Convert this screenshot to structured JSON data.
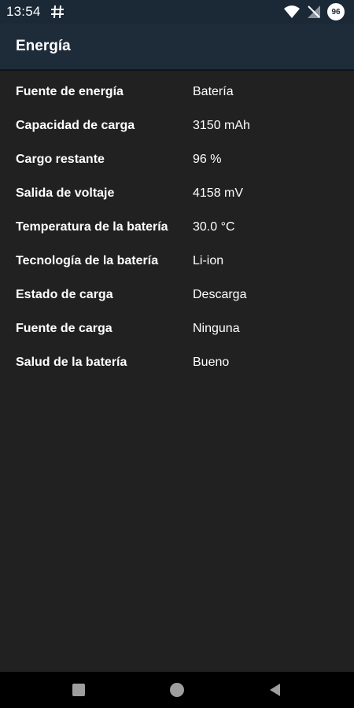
{
  "status_bar": {
    "time": "13:54",
    "battery_level": "96",
    "icons": [
      "hash-icon",
      "wifi-icon",
      "no-signal-icon",
      "battery-saver-icon"
    ]
  },
  "app_bar": {
    "title": "Energía"
  },
  "rows": [
    {
      "label": "Fuente de energía",
      "value": "Batería"
    },
    {
      "label": "Capacidad de carga",
      "value": "3150 mAh"
    },
    {
      "label": "Cargo restante",
      "value": "96 %"
    },
    {
      "label": "Salida de voltaje",
      "value": "4158 mV"
    },
    {
      "label": "Temperatura de la batería",
      "value": "30.0 °C"
    },
    {
      "label": "Tecnología de la batería",
      "value": "Li-ion"
    },
    {
      "label": "Estado de carga",
      "value": "Descarga"
    },
    {
      "label": "Fuente de carga",
      "value": "Ninguna"
    },
    {
      "label": "Salud de la batería",
      "value": "Bueno"
    }
  ],
  "nav_bar": {
    "icons": [
      "recents-square-icon",
      "home-circle-icon",
      "back-triangle-icon"
    ]
  },
  "colors": {
    "background": "#212121",
    "app_bar": "#1e2c3a",
    "status_bar": "#1b2836",
    "nav_bar": "#000000"
  }
}
